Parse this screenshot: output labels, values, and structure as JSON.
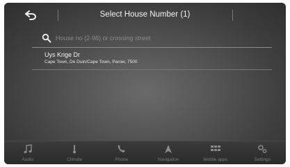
{
  "header": {
    "title": "Select House Number (1)"
  },
  "search": {
    "placeholder": "House no (2-98) or crossing street"
  },
  "results": [
    {
      "title": "Uys Krige Dr",
      "subtitle": "Cape Town, De Duin/Cape Town, Parow, 7500"
    }
  ],
  "nav": [
    {
      "label": "Audio",
      "icon": "music-note-icon"
    },
    {
      "label": "Climate",
      "icon": "climate-icon"
    },
    {
      "label": "Phone",
      "icon": "phone-icon"
    },
    {
      "label": "Navigation",
      "icon": "navigation-icon"
    },
    {
      "label": "Mobile apps",
      "icon": "apps-grid-icon"
    },
    {
      "label": "Settings",
      "icon": "gear-icon"
    }
  ],
  "colors": {
    "background": "#4a4a4a",
    "text": "#f2f2f2",
    "nav_text": "#7a7a7a"
  }
}
